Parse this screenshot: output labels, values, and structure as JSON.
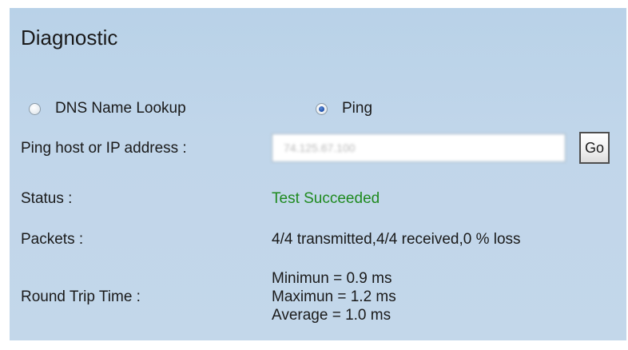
{
  "panel": {
    "title": "Diagnostic"
  },
  "mode": {
    "options": [
      {
        "label": "DNS Name Lookup",
        "selected": false
      },
      {
        "label": "Ping",
        "selected": true
      }
    ]
  },
  "ping": {
    "host_label": "Ping host or IP address :",
    "host_value": "74.125.67.100",
    "go_label": "Go"
  },
  "results": {
    "status_label": "Status :",
    "status_value": "Test Succeeded",
    "status_color": "#1f8a1f",
    "packets_label": "Packets :",
    "packets_value": "4/4 transmitted,4/4 received,0 % loss",
    "rtt_label": "Round Trip Time :",
    "rtt_min": "Minimun = 0.9 ms",
    "rtt_max": "Maximun = 1.2 ms",
    "rtt_avg": "Average = 1.0 ms"
  },
  "colors": {
    "panel_bg": "#c1d6ea",
    "selected_radio": "#1f4fa8"
  }
}
